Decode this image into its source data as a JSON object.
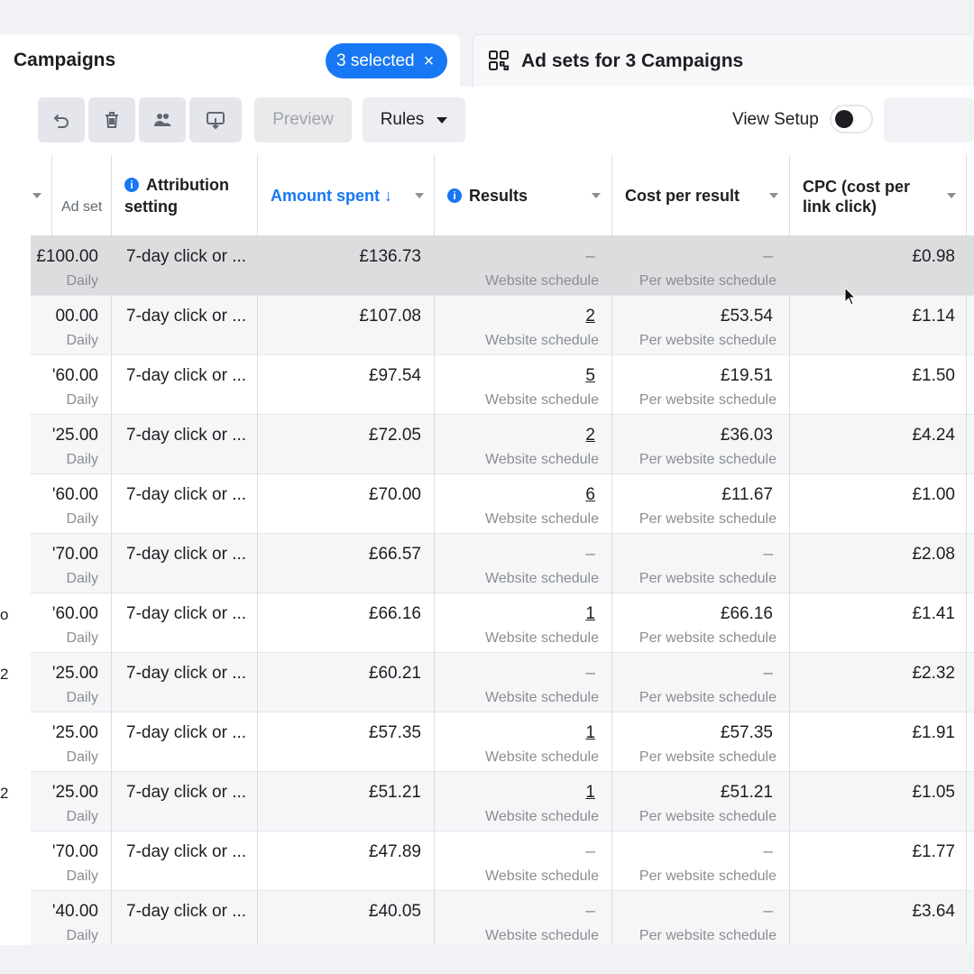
{
  "header": {
    "tab_campaigns": "Campaigns",
    "selected_pill": "3 selected",
    "selected_close": "×",
    "tab_adsets": "Ad sets for 3 Campaigns"
  },
  "toolbar": {
    "preview": "Preview",
    "rules": "Rules",
    "view_setup": "View Setup"
  },
  "table": {
    "headers": {
      "adset": "Ad set",
      "attribution_line1": "Attribution",
      "attribution_line2": "setting",
      "amount_spent": "Amount spent ↓",
      "results": "Results",
      "cost_per_result": "Cost per result",
      "cpc_line1": "CPC (cost per",
      "cpc_line2": "link click)"
    },
    "rows": [
      {
        "edge": "",
        "budget": "£100.00",
        "period": "Daily",
        "attribution": "7-day click or ...",
        "spent": "£136.73",
        "results": "–",
        "results_sub": "Website schedule",
        "cpr": "–",
        "cpr_sub": "Per website schedule",
        "cpc": "£0.98"
      },
      {
        "edge": "",
        "budget": "00.00",
        "period": "Daily",
        "attribution": "7-day click or ...",
        "spent": "£107.08",
        "results": "2",
        "results_sub": "Website schedule",
        "cpr": "£53.54",
        "cpr_sub": "Per website schedule",
        "cpc": "£1.14"
      },
      {
        "edge": "",
        "budget": "'60.00",
        "period": "Daily",
        "attribution": "7-day click or ...",
        "spent": "£97.54",
        "results": "5",
        "results_sub": "Website schedule",
        "cpr": "£19.51",
        "cpr_sub": "Per website schedule",
        "cpc": "£1.50"
      },
      {
        "edge": "",
        "budget": "'25.00",
        "period": "Daily",
        "attribution": "7-day click or ...",
        "spent": "£72.05",
        "results": "2",
        "results_sub": "Website schedule",
        "cpr": "£36.03",
        "cpr_sub": "Per website schedule",
        "cpc": "£4.24"
      },
      {
        "edge": "",
        "budget": "'60.00",
        "period": "Daily",
        "attribution": "7-day click or ...",
        "spent": "£70.00",
        "results": "6",
        "results_sub": "Website schedule",
        "cpr": "£11.67",
        "cpr_sub": "Per website schedule",
        "cpc": "£1.00"
      },
      {
        "edge": "",
        "budget": "'70.00",
        "period": "Daily",
        "attribution": "7-day click or ...",
        "spent": "£66.57",
        "results": "–",
        "results_sub": "Website schedule",
        "cpr": "–",
        "cpr_sub": "Per website schedule",
        "cpc": "£2.08"
      },
      {
        "edge": "o",
        "budget": "'60.00",
        "period": "Daily",
        "attribution": "7-day click or ...",
        "spent": "£66.16",
        "results": "1",
        "results_sub": "Website schedule",
        "cpr": "£66.16",
        "cpr_sub": "Per website schedule",
        "cpc": "£1.41"
      },
      {
        "edge": "2",
        "budget": "'25.00",
        "period": "Daily",
        "attribution": "7-day click or ...",
        "spent": "£60.21",
        "results": "–",
        "results_sub": "Website schedule",
        "cpr": "–",
        "cpr_sub": "Per website schedule",
        "cpc": "£2.32"
      },
      {
        "edge": "",
        "budget": "'25.00",
        "period": "Daily",
        "attribution": "7-day click or ...",
        "spent": "£57.35",
        "results": "1",
        "results_sub": "Website schedule",
        "cpr": "£57.35",
        "cpr_sub": "Per website schedule",
        "cpc": "£1.91"
      },
      {
        "edge": "2",
        "budget": "'25.00",
        "period": "Daily",
        "attribution": "7-day click or ...",
        "spent": "£51.21",
        "results": "1",
        "results_sub": "Website schedule",
        "cpr": "£51.21",
        "cpr_sub": "Per website schedule",
        "cpc": "£1.05"
      },
      {
        "edge": "",
        "budget": "'70.00",
        "period": "Daily",
        "attribution": "7-day click or ...",
        "spent": "£47.89",
        "results": "–",
        "results_sub": "Website schedule",
        "cpr": "–",
        "cpr_sub": "Per website schedule",
        "cpc": "£1.77"
      },
      {
        "edge": "",
        "budget": "'40.00",
        "period": "Daily",
        "attribution": "7-day click or ...",
        "spent": "£40.05",
        "results": "–",
        "results_sub": "Website schedule",
        "cpr": "–",
        "cpr_sub": "Per website schedule",
        "cpc": "£3.64"
      }
    ]
  },
  "icons": [
    "undo-icon",
    "trash-icon",
    "people-icon",
    "export-icon",
    "grid-icon",
    "info-icon",
    "cursor-icon"
  ],
  "colors": {
    "accent": "#1877f2",
    "highlight_row": "#dcdddf"
  }
}
